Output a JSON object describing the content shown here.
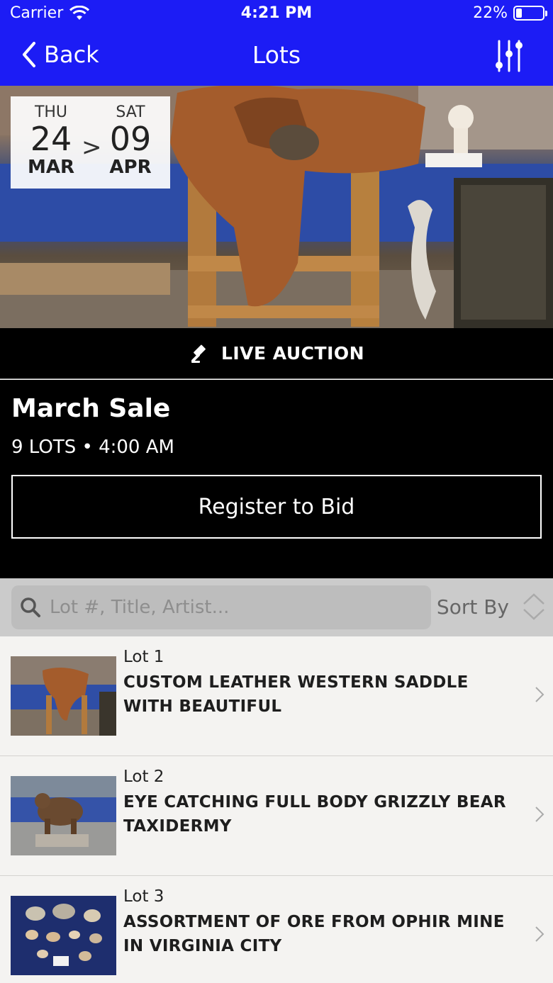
{
  "status": {
    "carrier": "Carrier",
    "time": "4:21 PM",
    "battery": "22%",
    "battery_level": 0.22
  },
  "nav": {
    "back_label": "Back",
    "title": "Lots",
    "filter_icon": "sliders-icon"
  },
  "hero": {
    "start": {
      "day": "THU",
      "date": "24",
      "month": "MAR"
    },
    "end": {
      "day": "SAT",
      "date": "09",
      "month": "APR"
    },
    "separator": ">"
  },
  "live": {
    "label": "LIVE AUCTION",
    "icon": "gavel-icon"
  },
  "sale": {
    "title": "March Sale",
    "meta": "9 LOTS • 4:00 AM",
    "register_label": "Register to Bid"
  },
  "search": {
    "placeholder": "Lot #, Title, Artist...",
    "sort_label": "Sort By"
  },
  "lots": [
    {
      "number": "Lot 1",
      "title": "CUSTOM LEATHER WESTERN SADDLE WITH BEAUTIFUL"
    },
    {
      "number": "Lot 2",
      "title": "EYE CATCHING FULL BODY GRIZZLY BEAR TAXIDERMY"
    },
    {
      "number": "Lot 3",
      "title": "ASSORTMENT OF ORE FROM OPHIR MINE IN VIRGINIA CITY"
    }
  ],
  "colors": {
    "nav_bg": "#1c1cf5",
    "band_bg": "#000000",
    "list_bg": "#f4f3f1"
  }
}
